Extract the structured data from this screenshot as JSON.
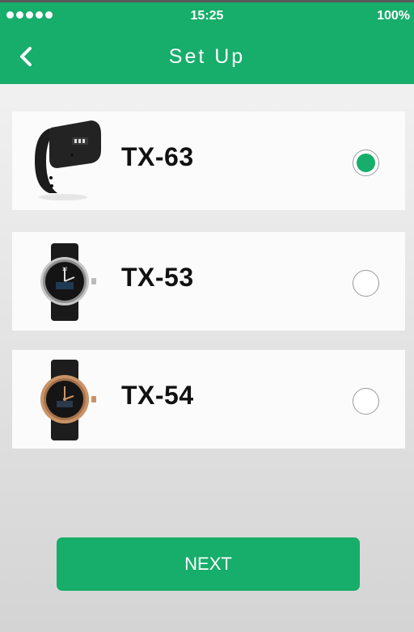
{
  "status_bar": {
    "time": "15:25",
    "battery": "100%",
    "signal_bars": 5
  },
  "header": {
    "title": "Set Up",
    "back_icon": "chevron-left-icon"
  },
  "devices": [
    {
      "name": "TX-63",
      "image": "fitness-band-image",
      "selected": true
    },
    {
      "name": "TX-53",
      "image": "silver-watch-image",
      "selected": false
    },
    {
      "name": "TX-54",
      "image": "rose-gold-watch-image",
      "selected": false
    }
  ],
  "next_label": "NEXT",
  "colors": {
    "accent": "#17ad6a",
    "background": "#f0f0f0",
    "card": "#fbfbfb"
  }
}
